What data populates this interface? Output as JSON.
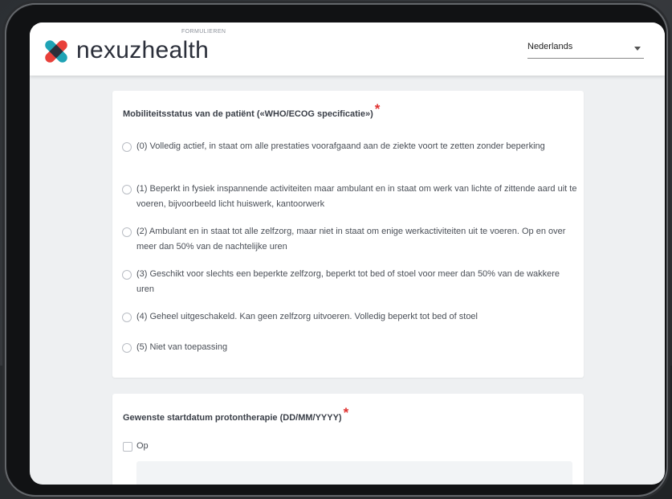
{
  "header": {
    "brand": "nexuzhealth",
    "section_label": "FORMULIEREN",
    "language_select": {
      "selected": "Nederlands"
    }
  },
  "questions": [
    {
      "title": "Mobiliteitsstatus van de patiënt («WHO/ECOG specificatie»)",
      "required_mark": "*",
      "options": [
        "(0) Volledig actief, in staat om alle prestaties voorafgaand aan de ziekte voort te zetten zonder beperking",
        "(1) Beperkt in fysiek inspannende activiteiten maar ambulant en in staat om werk van lichte of zittende aard uit te voeren, bijvoorbeeld licht huiswerk, kantoorwerk",
        "(2) Ambulant en in staat tot alle zelfzorg, maar niet in staat om enige werkactiviteiten uit te voeren. Op en over meer dan 50% van de nachtelijke uren",
        "(3) Geschikt voor slechts een beperkte zelfzorg, beperkt tot bed of stoel voor meer dan 50% van de wakkere uren",
        "(4) Geheel uitgeschakeld. Kan geen zelfzorg uitvoeren. Volledig beperkt tot bed of stoel",
        "(5) Niet van toepassing"
      ]
    },
    {
      "title": "Gewenste startdatum protontherapie (DD/MM/YYYY)",
      "required_mark": "*",
      "checkbox_label": "Op"
    }
  ],
  "colors": {
    "accent_red": "#e0312f",
    "logo_red": "#e8403a",
    "logo_teal": "#1fa3b5",
    "logo_dark": "#2b2f3a"
  }
}
